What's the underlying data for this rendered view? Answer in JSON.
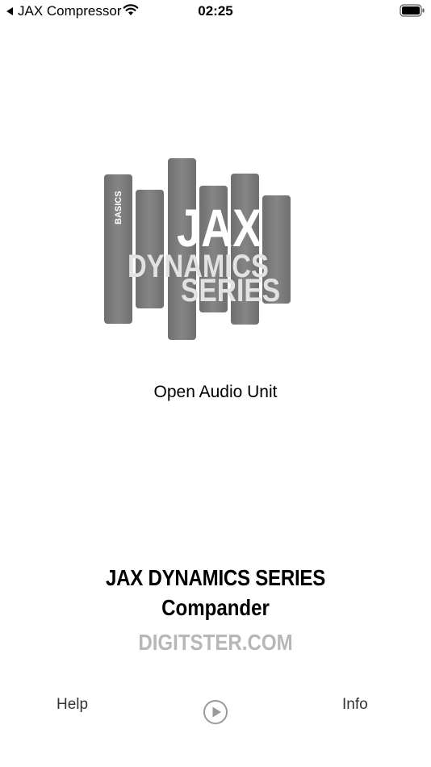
{
  "status_bar": {
    "back_app_label": "JAX Compressor",
    "time": "02:25",
    "icons": [
      "chevron-left-icon",
      "wifi-icon",
      "battery-icon"
    ]
  },
  "logo": {
    "badge_text": "BASICS",
    "line1": "JAX",
    "line2": "DYNAMICS",
    "line3": "SERIES",
    "colors": {
      "bars": "#7a7a7a",
      "text_white": "#ffffff",
      "text_light": "#e2e2e2"
    }
  },
  "main": {
    "open_audio_unit_label": "Open Audio Unit",
    "product_title": "JAX DYNAMICS SERIES",
    "product_name": "Compander",
    "website": "DIGITSTER.COM"
  },
  "bottom_bar": {
    "help_label": "Help",
    "info_label": "Info",
    "play_icon": "play-circle-icon"
  }
}
